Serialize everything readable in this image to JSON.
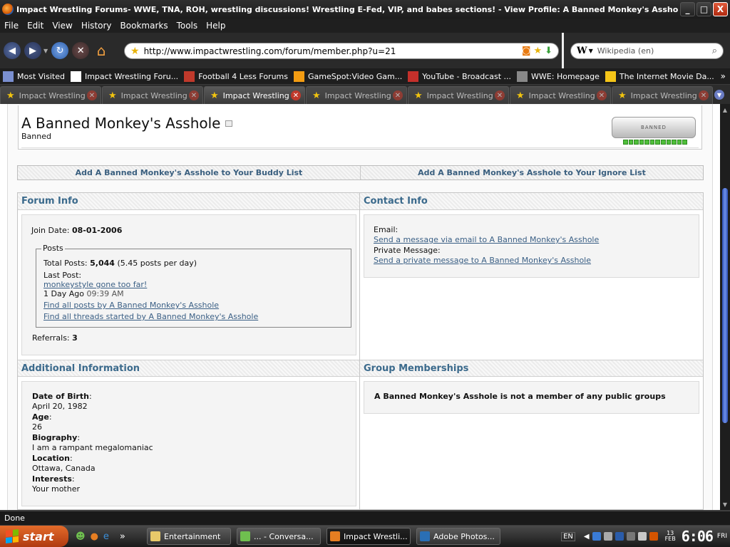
{
  "window": {
    "title": "Impact Wrestling Forums- WWE, TNA, ROH, wrestling discussions! Wrestling E-Fed, VIP, and babes sections! - View Profile: A Banned Monkey's Asshole - Mozilla Firefox",
    "controls": {
      "minimize": "_",
      "maximize": "□",
      "close": "X"
    }
  },
  "menu": [
    "File",
    "Edit",
    "View",
    "History",
    "Bookmarks",
    "Tools",
    "Help"
  ],
  "nav": {
    "url": "http://www.impactwrestling.com/forum/member.php?u=21",
    "search_placeholder": "Wikipedia (en)",
    "search_engine_icon": "W"
  },
  "bookmarks": [
    {
      "label": "Most Visited",
      "icon": "most-visited-icon",
      "color": "#7a8fd0"
    },
    {
      "label": "Impact Wrestling Foru...",
      "icon": "g-icon",
      "color": "#ffffff"
    },
    {
      "label": "Football 4 Less Forums",
      "icon": "football-icon",
      "color": "#c0392b"
    },
    {
      "label": "GameSpot:Video Gam...",
      "icon": "gamespot-icon",
      "color": "#f39c12"
    },
    {
      "label": "YouTube - Broadcast ...",
      "icon": "youtube-icon",
      "color": "#c4302b"
    },
    {
      "label": "WWE: Homepage",
      "icon": "wwe-icon",
      "color": "#888888"
    },
    {
      "label": "The Internet Movie Da...",
      "icon": "imdb-icon",
      "color": "#f5c518"
    }
  ],
  "bookmarks_overflow": "»",
  "tabs": [
    {
      "label": "Impact Wrestling ...",
      "active": false
    },
    {
      "label": "Impact Wrestling ...",
      "active": false
    },
    {
      "label": "Impact Wrestling ...",
      "active": true
    },
    {
      "label": "Impact Wrestling ...",
      "active": false
    },
    {
      "label": "Impact Wrestling ...",
      "active": false
    },
    {
      "label": "Impact Wrestling ...",
      "active": false
    },
    {
      "label": "Impact Wrestling ...",
      "active": false
    }
  ],
  "profile": {
    "username": "A Banned Monkey's Asshole",
    "user_title": "Banned",
    "banned_plate": "BANNED",
    "reputation_pips": 12,
    "buddy_link": "Add A Banned Monkey's Asshole to Your Buddy List",
    "ignore_link": "Add A Banned Monkey's Asshole to Your Ignore List"
  },
  "forum_info": {
    "heading": "Forum Info",
    "join_label": "Join Date:",
    "join_date": "08-01-2006",
    "posts_legend": "Posts",
    "total_posts_label": "Total Posts:",
    "total_posts": "5,044",
    "posts_per_day": "(5.45 posts per day)",
    "last_post_label": "Last Post:",
    "last_post_link": "monkeystyle gone too far!",
    "last_post_date": "1 Day Ago",
    "last_post_time": "09:39 AM",
    "find_posts": "Find all posts by A Banned Monkey's Asshole",
    "find_threads": "Find all threads started by A Banned Monkey's Asshole",
    "referrals_label": "Referrals:",
    "referrals": "3"
  },
  "contact_info": {
    "heading": "Contact Info",
    "email_label": "Email:",
    "email_link": "Send a message via email to A Banned Monkey's Asshole",
    "pm_label": "Private Message:",
    "pm_link": "Send a private message to A Banned Monkey's Asshole"
  },
  "additional_info": {
    "heading": "Additional Information",
    "fields": [
      {
        "label": "Date of Birth",
        "value": "April 20, 1982"
      },
      {
        "label": "Age",
        "value": "26"
      },
      {
        "label": "Biography",
        "value": "I am a rampant megalomaniac"
      },
      {
        "label": "Location",
        "value": "Ottawa, Canada"
      },
      {
        "label": "Interests",
        "value": "Your mother"
      }
    ]
  },
  "group_memberships": {
    "heading": "Group Memberships",
    "text": "A Banned Monkey's Asshole is not a member of any public groups"
  },
  "status": "Done",
  "taskbar": {
    "start_label": "start",
    "quick_launch_more": "»",
    "buttons": [
      {
        "label": "Entertainment",
        "color": "#e8c96a",
        "active": false
      },
      {
        "label": "... - Conversa...",
        "color": "#6fbf4f",
        "active": false
      },
      {
        "label": "Impact Wrestli...",
        "color": "#e67e22",
        "active": true
      },
      {
        "label": "Adobe Photos...",
        "color": "#2a6fb5",
        "active": false
      }
    ],
    "tray": {
      "lang": "EN",
      "day": "13",
      "month": "FEB",
      "time": "6:06",
      "weekday": "FRI"
    }
  }
}
